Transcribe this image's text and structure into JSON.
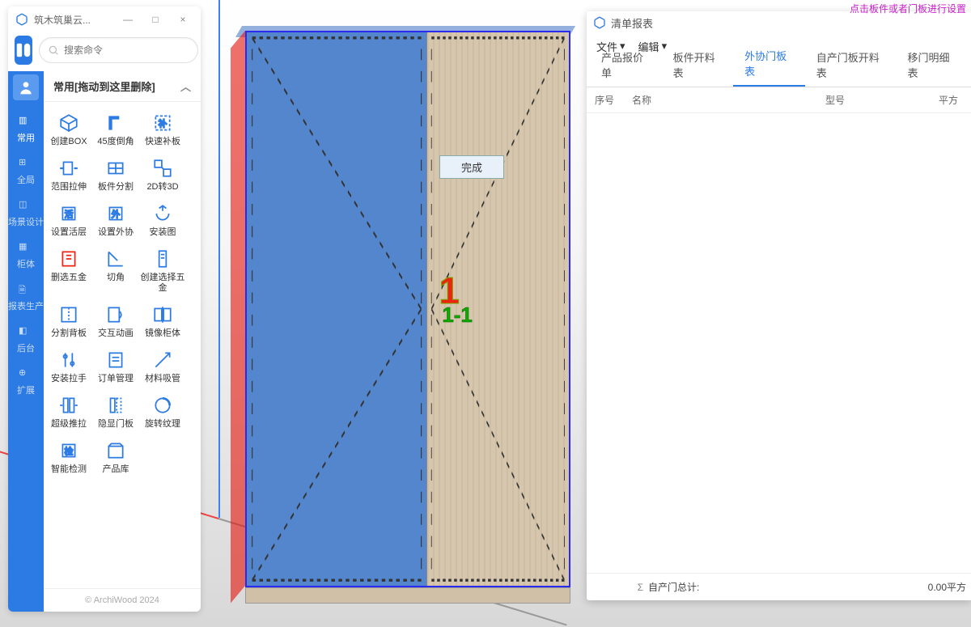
{
  "window": {
    "title": "筑木筑巢云...",
    "minimize": "—",
    "maximize": "□",
    "close": "×"
  },
  "search": {
    "placeholder": "搜索命令"
  },
  "side_nav": [
    {
      "label": "常用"
    },
    {
      "label": "全局"
    },
    {
      "label": "场景设计"
    },
    {
      "label": "柜体"
    },
    {
      "label": "报表生产"
    },
    {
      "label": "后台"
    },
    {
      "label": "扩展"
    }
  ],
  "panel_title": "常用[拖动到这里删除]",
  "tools": [
    {
      "label": "创建BOX"
    },
    {
      "label": "45度倒角"
    },
    {
      "label": "快速补板"
    },
    {
      "label": "范围拉伸"
    },
    {
      "label": "板件分割"
    },
    {
      "label": "2D转3D"
    },
    {
      "label": "设置活层"
    },
    {
      "label": "设置外协"
    },
    {
      "label": "安装图"
    },
    {
      "label": "删选五金"
    },
    {
      "label": "切角"
    },
    {
      "label": "创建选择五金"
    },
    {
      "label": "分割背板"
    },
    {
      "label": "交互动画"
    },
    {
      "label": "镜像柜体"
    },
    {
      "label": "安装拉手"
    },
    {
      "label": "订单管理"
    },
    {
      "label": "材料吸管"
    },
    {
      "label": "超级推拉"
    },
    {
      "label": "隐显门板"
    },
    {
      "label": "旋转纹理"
    },
    {
      "label": "智能检测"
    },
    {
      "label": "产品库"
    }
  ],
  "footer": "© ArchiWood 2024",
  "viewport": {
    "tooltip": "完成",
    "label_big": "1",
    "label_small": "1-1"
  },
  "report": {
    "tip": "点击板件或者门板进行设置",
    "title": "清单报表",
    "menu_file": "文件",
    "menu_edit": "编辑",
    "tabs": [
      {
        "label": "产品报价单"
      },
      {
        "label": "板件开料表"
      },
      {
        "label": "外协门板表",
        "active": true
      },
      {
        "label": "自产门板开料表"
      },
      {
        "label": "移门明细表"
      }
    ],
    "thead": {
      "sn": "序号",
      "name": "名称",
      "model": "型号",
      "area": "平方"
    },
    "tfoot": {
      "sigma": "Σ",
      "label": "自产门总计:",
      "value": "0.00平方"
    }
  }
}
